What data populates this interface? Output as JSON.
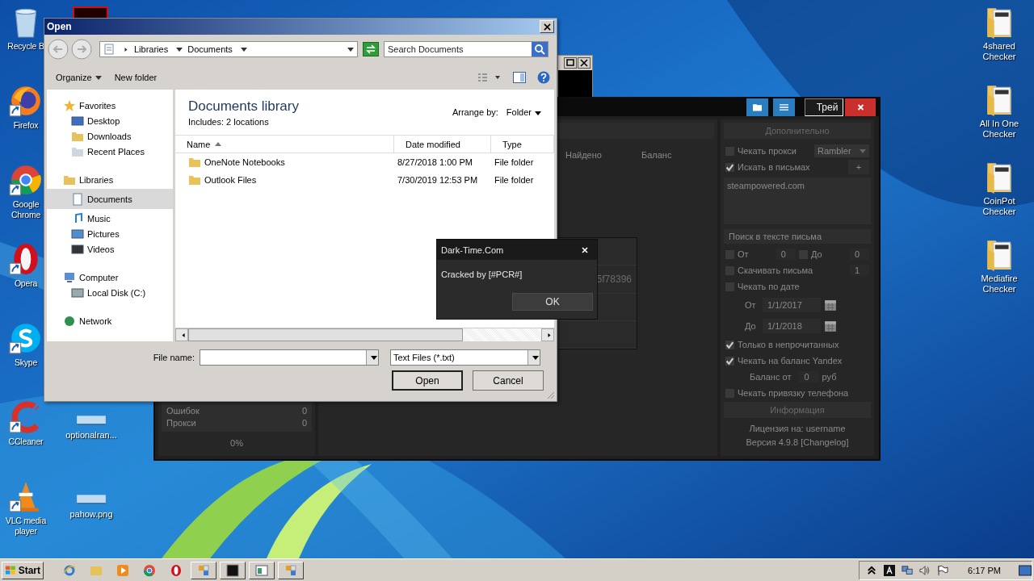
{
  "desktop": {
    "left_icons": [
      {
        "label": "Recycle B",
        "kind": "bin",
        "shortcut": false
      },
      {
        "label": "Firefox",
        "kind": "firefox",
        "shortcut": true
      },
      {
        "label": "Google Chrome",
        "kind": "chrome",
        "shortcut": true
      },
      {
        "label": "Opera",
        "kind": "opera",
        "shortcut": true
      },
      {
        "label": "Skype",
        "kind": "skype",
        "shortcut": true
      },
      {
        "label": "CCleaner",
        "kind": "ccleaner",
        "shortcut": true
      },
      {
        "label": "VLC media player",
        "kind": "vlc",
        "shortcut": true
      }
    ],
    "second_icons": [
      {
        "label": "optionalran..."
      },
      {
        "label": "pahow.png"
      }
    ],
    "right_icons": [
      {
        "label": "4shared Checker",
        "kind": "folder"
      },
      {
        "label": "All In One Checker",
        "kind": "folder"
      },
      {
        "label": "CoinPot Checker",
        "kind": "folder"
      },
      {
        "label": "Mediafire Checker",
        "kind": "folder"
      }
    ]
  },
  "app": {
    "tray_button": "Трей",
    "stats": [
      {
        "label": "Ошибок",
        "value": "0"
      },
      {
        "label": "Прокси",
        "value": "0"
      }
    ],
    "progress": "0%",
    "columns": [
      "Найдено",
      "Баланс"
    ],
    "list_text": "5f78396",
    "panel_title": "Дополнительно",
    "options": [
      {
        "kind": "check_select",
        "label": "Чекать прокси",
        "checked": false,
        "value": "Rambler"
      },
      {
        "kind": "check_add",
        "label": "Искать в письмах",
        "checked": true,
        "button": "+"
      },
      {
        "kind": "textarea",
        "value": "steampowered.com"
      },
      {
        "kind": "select",
        "value": "Поиск в тексте письма"
      },
      {
        "kind": "range",
        "items": [
          {
            "label": "От",
            "checked": false,
            "value": "0"
          },
          {
            "label": "До",
            "checked": false,
            "value": "0"
          }
        ]
      },
      {
        "kind": "check_spin",
        "label": "Скачивать письма",
        "checked": false,
        "value": "1"
      },
      {
        "kind": "check",
        "label": "Чекать по дате",
        "checked": false
      },
      {
        "kind": "date",
        "label": "От",
        "value": "1/1/2017"
      },
      {
        "kind": "date",
        "label": "До",
        "value": "1/1/2018"
      },
      {
        "kind": "check",
        "label": "Только в непрочитанных",
        "checked": true
      },
      {
        "kind": "check",
        "label": "Чекать на баланс Yandex",
        "checked": true
      },
      {
        "kind": "spin_unit",
        "label": "Баланс от",
        "value": "0",
        "unit": "руб"
      },
      {
        "kind": "check",
        "label": "Чекать привязку телефона",
        "checked": false
      }
    ],
    "info_title": "Информация",
    "info_lines": [
      "Лицензия на: username",
      "Версия 4.9.8 [Changelog]"
    ]
  },
  "open_dialog": {
    "title": "Open",
    "breadcrumbs": [
      "Libraries",
      "Documents"
    ],
    "search": {
      "placeholder": "Search Documents"
    },
    "toolbar": [
      "Organize",
      "New folder"
    ],
    "nav": [
      {
        "label": "Favorites",
        "kind": "star",
        "selected": false,
        "children": [
          {
            "label": "Desktop",
            "kind": "desktop",
            "selected": false
          },
          {
            "label": "Downloads",
            "kind": "downloads",
            "selected": false
          },
          {
            "label": "Recent Places",
            "kind": "recent",
            "selected": false
          }
        ]
      },
      {
        "label": "Libraries",
        "kind": "library",
        "selected": false,
        "children": [
          {
            "label": "Documents",
            "kind": "documents",
            "selected": true
          },
          {
            "label": "Music",
            "kind": "music",
            "selected": false
          },
          {
            "label": "Pictures",
            "kind": "pictures",
            "selected": false
          },
          {
            "label": "Videos",
            "kind": "videos",
            "selected": false
          }
        ]
      },
      {
        "label": "Computer",
        "kind": "computer",
        "selected": false,
        "children": [
          {
            "label": "Local Disk (C:)",
            "kind": "disk",
            "selected": false
          }
        ]
      },
      {
        "label": "Network",
        "kind": "network",
        "selected": false
      }
    ],
    "library_title": "Documents library",
    "includes_label": "Includes:",
    "includes_link": "2 locations",
    "arrange_label": "Arrange by:",
    "arrange_value": "Folder",
    "columns": [
      {
        "label": "Name",
        "sorted": true
      },
      {
        "label": "Date modified",
        "sorted": false
      },
      {
        "label": "Type",
        "sorted": false
      }
    ],
    "files": [
      {
        "name": "OneNote Notebooks",
        "date": "8/27/2018 1:00 PM",
        "type": "File folder"
      },
      {
        "name": "Outlook Files",
        "date": "7/30/2019 12:53 PM",
        "type": "File folder"
      }
    ],
    "file_name_label": "File name:",
    "file_type": "Text Files (*.txt)",
    "buttons": [
      "Open",
      "Cancel"
    ]
  },
  "message_box": {
    "title": "Dark-Time.Com",
    "text": "Cracked by [#PCR#]",
    "button": "OK"
  },
  "taskbar": {
    "start": "Start",
    "quick_launch": [
      {
        "kind": "ie"
      },
      {
        "kind": "explorer"
      },
      {
        "kind": "media"
      },
      {
        "kind": "chrome"
      },
      {
        "kind": "opera"
      }
    ],
    "tasks": [
      {
        "kind": "app"
      },
      {
        "kind": "terminal"
      },
      {
        "kind": "window"
      },
      {
        "kind": "app"
      }
    ],
    "clock": "6:17 PM"
  }
}
